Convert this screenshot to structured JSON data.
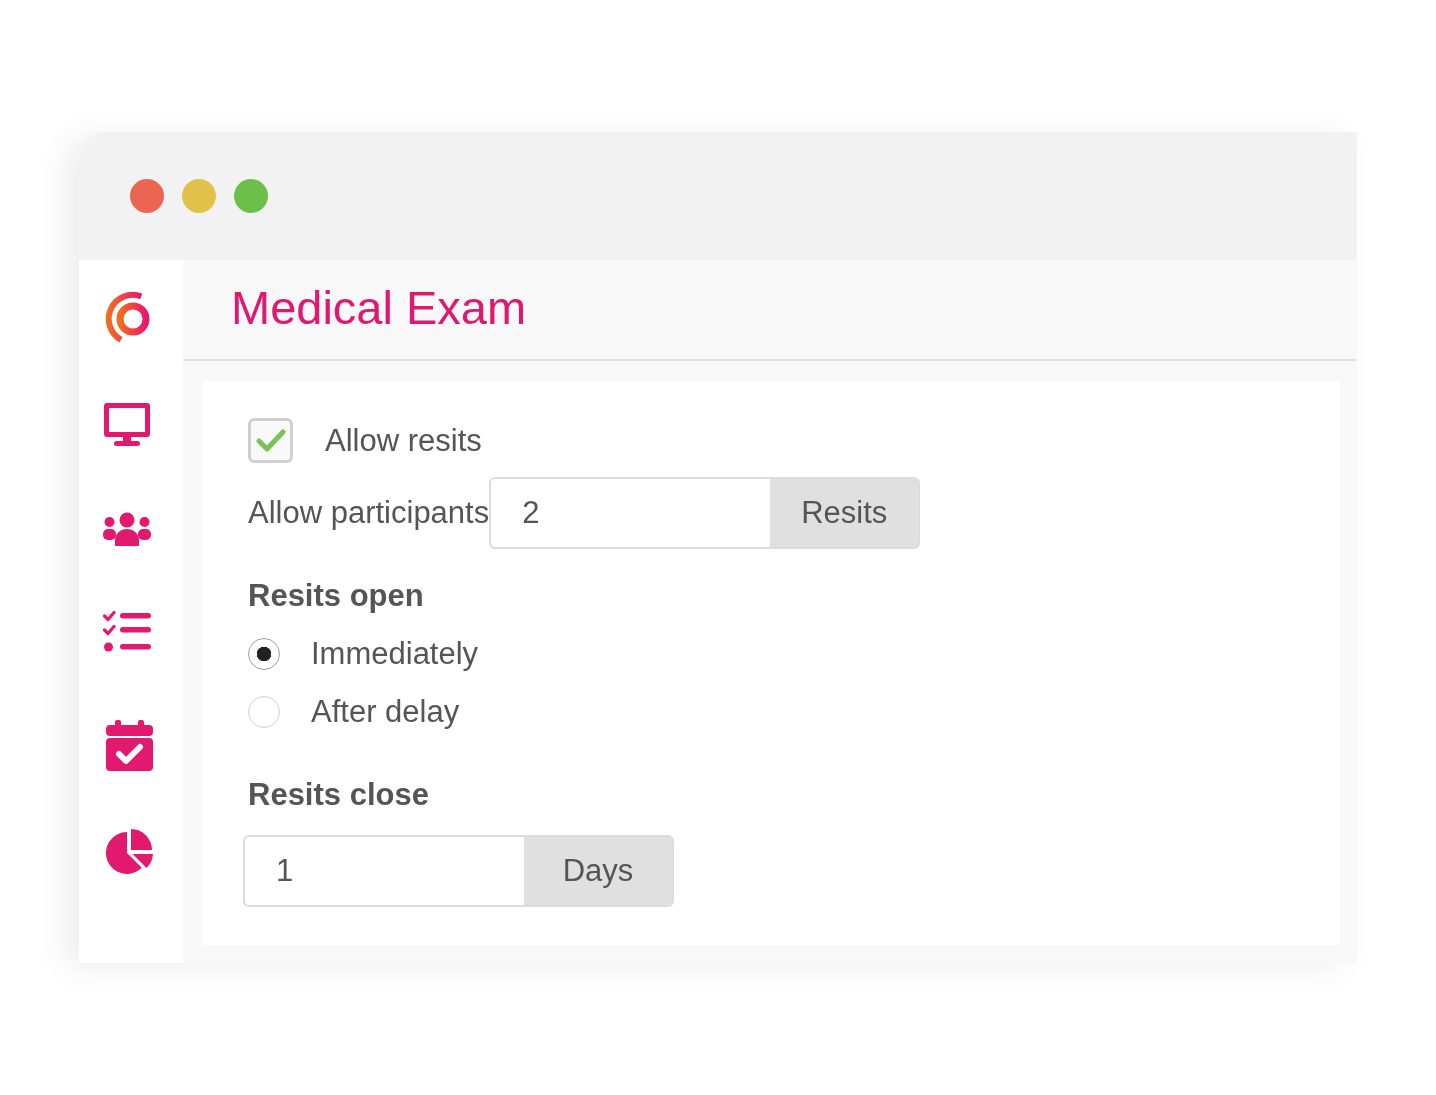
{
  "window": {
    "title": "Medical Exam"
  },
  "allow_resits": {
    "label": "Allow resits",
    "checked": true
  },
  "participants": {
    "label": "Allow participants",
    "value": "2",
    "unit": "Resits"
  },
  "resits_open": {
    "heading": "Resits open",
    "options": [
      {
        "label": "Immediately",
        "selected": true
      },
      {
        "label": "After delay",
        "selected": false
      }
    ]
  },
  "resits_close": {
    "heading": "Resits close",
    "value": "1",
    "unit": "Days"
  }
}
